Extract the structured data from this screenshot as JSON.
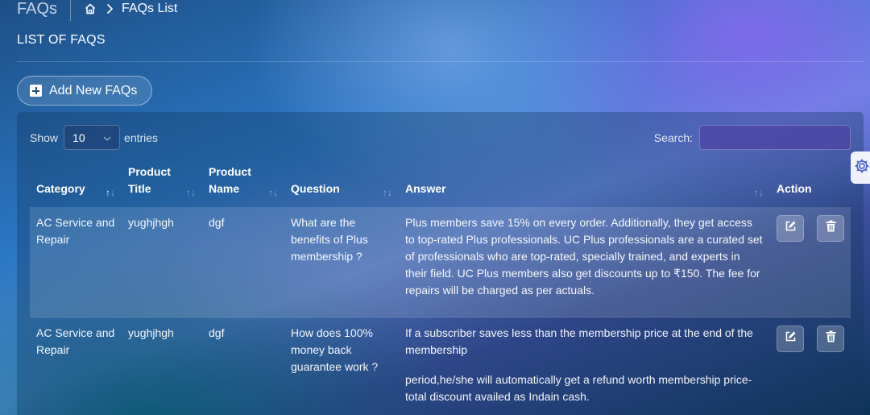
{
  "header": {
    "page_title": "FAQs",
    "breadcrumb": {
      "current": "FAQs List"
    }
  },
  "section_title": "LIST OF FAQS",
  "add_button_label": "Add New FAQs",
  "table_controls": {
    "show_label": "Show",
    "entries_value": "10",
    "entries_label": "entries",
    "search_label": "Search:",
    "search_value": ""
  },
  "table": {
    "headers": {
      "category": "Category",
      "product_title": "Product Title",
      "product_name": "Product Name",
      "question": "Question",
      "answer": "Answer",
      "action": "Action"
    },
    "rows": [
      {
        "category": "AC Service and Repair",
        "product_title": "yughjhgh",
        "product_name": "dgf",
        "question": "What are the benefits of Plus membership ?",
        "answer": [
          "Plus members save 15% on every order. Additionally, they get access to top-rated Plus professionals. UC Plus professionals are a curated set of professionals who are top-rated, specially trained, and experts in their field. UC Plus members also get discounts up to ₹150. The fee for repairs will be charged as per actuals."
        ]
      },
      {
        "category": "AC Service and Repair",
        "product_title": "yughjhgh",
        "product_name": "dgf",
        "question": "How does 100% money back guarantee work ?",
        "answer": [
          "If a subscriber saves less than the membership price at the end of the membership",
          "period,he/she will automatically get a refund worth membership price-total discount availed as Indain cash."
        ]
      }
    ]
  },
  "icons": {
    "home": "home-icon",
    "breadcrumb_separator": "chevron-right-icon",
    "add": "plus-square-icon",
    "dropdown": "chevron-down-icon",
    "sort": "sort-arrows-icon",
    "edit": "edit-icon",
    "delete": "trash-icon",
    "settings": "gear-icon"
  },
  "colors": {
    "search_field_bg": "#4b46a5",
    "settings_tab_bg": "#ffffff"
  }
}
